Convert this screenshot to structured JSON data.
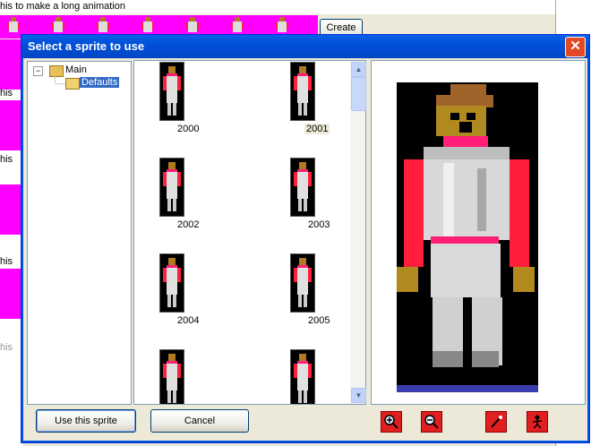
{
  "background": {
    "instruction_text": "his to make a long animation",
    "create_button": "Create",
    "left_fragments": [
      "his",
      "his",
      "his",
      "his"
    ]
  },
  "dialog": {
    "title": "Select a sprite to use",
    "close_glyph": "✕",
    "tree": {
      "expander_glyph": "−",
      "root": "Main",
      "child": "Defaults"
    },
    "sprites": [
      {
        "label": "2000",
        "selected": false
      },
      {
        "label": "2001",
        "selected": true
      },
      {
        "label": "2002",
        "selected": false
      },
      {
        "label": "2003",
        "selected": false
      },
      {
        "label": "2004",
        "selected": false
      },
      {
        "label": "2005",
        "selected": false
      },
      {
        "label": "",
        "selected": false
      },
      {
        "label": "",
        "selected": false
      }
    ],
    "buttons": {
      "use": "Use this sprite",
      "cancel": "Cancel"
    },
    "tools": [
      "zoom-in-icon",
      "zoom-out-icon",
      "magic-wand-icon",
      "character-icon"
    ],
    "colors": {
      "titlebar": "#0054E3",
      "tool_red": "#E02020",
      "sprite_red": "#FF1E3C",
      "sprite_pink": "#FF1E78"
    }
  }
}
